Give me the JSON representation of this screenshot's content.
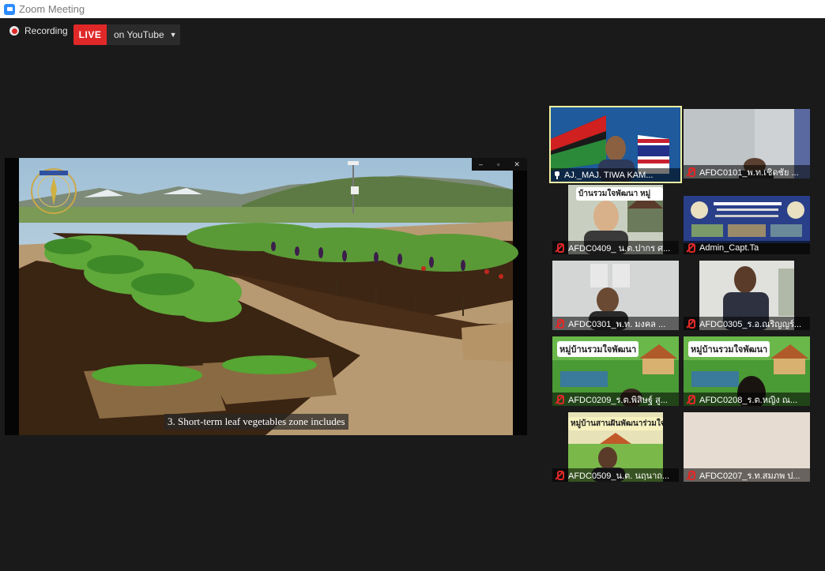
{
  "window": {
    "title": "Zoom Meeting",
    "app_icon": "zoom-icon"
  },
  "toolbar": {
    "recording_label": "Recording",
    "live_label": "LIVE",
    "stream_label": "on YouTube",
    "live_color": "#e02828"
  },
  "share": {
    "caption": "3. Short-term leaf vegetables zone includes",
    "window_controls": [
      "–",
      "▫",
      "✕"
    ]
  },
  "participants": [
    {
      "name": "AJ._MAJ. TIWA  KAM...",
      "active": true,
      "pinned": true,
      "muted": false
    },
    {
      "name": "AFDC0101_พ.ท.เชิดชัย ...",
      "muted": true
    },
    {
      "name": "AFDC0409_ น.ต.ปากร ศ...",
      "muted": true,
      "banner": "บ้านรวมใจพัฒนา หมู่"
    },
    {
      "name": "Admin_Capt.Ta",
      "muted": true
    },
    {
      "name": "AFDC0301_พ.ท. มงคล  ...",
      "muted": true
    },
    {
      "name": "AFDC0305_ร.อ.ณริญญร์...",
      "muted": true
    },
    {
      "name": "AFDC0209_ร.ต.พิสิษฐ์ สู...",
      "muted": true,
      "banner": "หมู่บ้านรวมใจพัฒนา"
    },
    {
      "name": "AFDC0208_ร.ต.หญิง ณ...",
      "muted": true,
      "banner": "หมู่บ้านรวมใจพัฒนา"
    },
    {
      "name": "AFDC0509_น.ต. นฤนาถ...",
      "muted": true,
      "banner": "หมู่บ้านสานฝันพัฒนาร่วมใจ"
    },
    {
      "name": "AFDC0207_ร.ท.สมภพ ป...",
      "muted": true
    }
  ]
}
